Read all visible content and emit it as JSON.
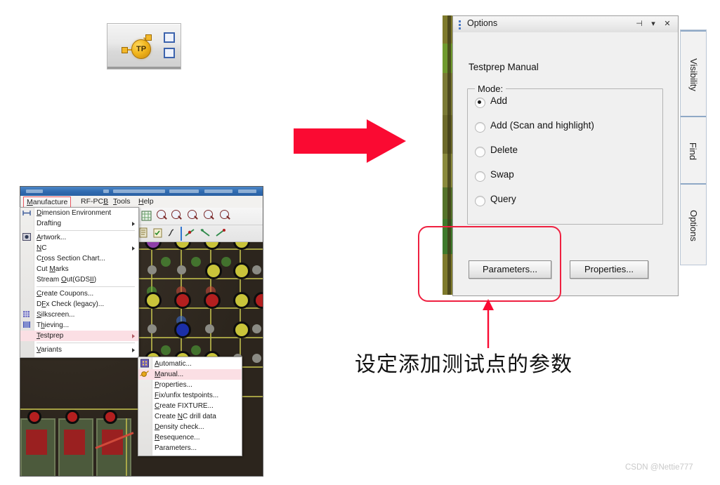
{
  "toolbar_fragment": {
    "icon_label": "TP",
    "icon_name": "testpoint-icon"
  },
  "app_window": {
    "menubar": [
      {
        "label": "Manufacture",
        "accel": "M",
        "highlighted": true
      },
      {
        "label": "RF-PCB",
        "accel": "B",
        "highlighted": false
      },
      {
        "label": "Tools",
        "accel": "T",
        "highlighted": false
      },
      {
        "label": "Help",
        "accel": "H",
        "highlighted": false
      }
    ]
  },
  "manufacture_menu": {
    "items": [
      {
        "label": "Dimension Environment",
        "icon": "dimension-icon",
        "submenu": false,
        "selected": false
      },
      {
        "label": "Drafting",
        "icon": "",
        "submenu": true,
        "selected": false
      },
      {
        "separator": true
      },
      {
        "label": "Artwork...",
        "icon": "artwork-icon",
        "submenu": false,
        "selected": false
      },
      {
        "label": "NC",
        "icon": "",
        "submenu": true,
        "selected": false
      },
      {
        "label": "Cross Section Chart...",
        "icon": "",
        "submenu": false,
        "selected": false
      },
      {
        "label": "Cut Marks",
        "icon": "",
        "submenu": false,
        "selected": false
      },
      {
        "label": "Stream Out(GDSII)",
        "icon": "",
        "submenu": false,
        "selected": false
      },
      {
        "separator": true
      },
      {
        "label": "Create Coupons...",
        "icon": "",
        "submenu": false,
        "selected": false
      },
      {
        "label": "DFx Check (legacy)...",
        "icon": "",
        "submenu": false,
        "selected": false
      },
      {
        "label": "Silkscreen...",
        "icon": "silkscreen-icon",
        "submenu": false,
        "selected": false
      },
      {
        "label": "Thieving...",
        "icon": "thieving-icon",
        "submenu": false,
        "selected": false
      },
      {
        "label": "Testprep",
        "icon": "",
        "submenu": true,
        "selected": true
      },
      {
        "separator": true
      },
      {
        "label": "Variants",
        "icon": "",
        "submenu": true,
        "selected": false
      }
    ]
  },
  "testprep_submenu": {
    "items": [
      {
        "label": "Automatic...",
        "icon": "automatic-testprep-icon",
        "selected": false
      },
      {
        "label": "Manual...",
        "icon": "manual-testprep-icon",
        "selected": true
      },
      {
        "label": "Properties...",
        "icon": "",
        "selected": false
      },
      {
        "label": "Fix/unfix testpoints...",
        "icon": "",
        "selected": false
      },
      {
        "label": "Create FIXTURE...",
        "icon": "",
        "selected": false
      },
      {
        "label": "Create NC drill data",
        "icon": "",
        "selected": false
      },
      {
        "label": "Density check...",
        "icon": "",
        "selected": false
      },
      {
        "label": "Resequence...",
        "icon": "",
        "selected": false
      },
      {
        "label": "Parameters...",
        "icon": "",
        "selected": false
      }
    ]
  },
  "options_panel": {
    "title": "Options",
    "titlebar_buttons": [
      {
        "name": "auto-hide-pin-button",
        "glyph": "⊣"
      },
      {
        "name": "panel-menu-button",
        "glyph": "▾"
      },
      {
        "name": "close-button",
        "glyph": "✕"
      }
    ],
    "subtitle": "Testprep Manual",
    "mode_group": {
      "legend": "Mode:",
      "options": [
        {
          "label": "Add",
          "checked": true
        },
        {
          "label": "Add (Scan and highlight)",
          "checked": false
        },
        {
          "label": "Delete",
          "checked": false
        },
        {
          "label": "Swap",
          "checked": false
        },
        {
          "label": "Query",
          "checked": false
        }
      ]
    },
    "buttons": [
      {
        "label": "Parameters...",
        "name": "parameters-button"
      },
      {
        "label": "Properties...",
        "name": "properties-button"
      }
    ]
  },
  "side_tabs": [
    {
      "label": "Visibility"
    },
    {
      "label": "Find"
    },
    {
      "label": "Options"
    }
  ],
  "annotations": {
    "caption_plain_1": "设",
    "caption_full": "设定添加测试点的参数",
    "highlight_color": "#ef2040",
    "arrow_color": "#fa0a32"
  },
  "watermark": "CSDN @Nettie777"
}
